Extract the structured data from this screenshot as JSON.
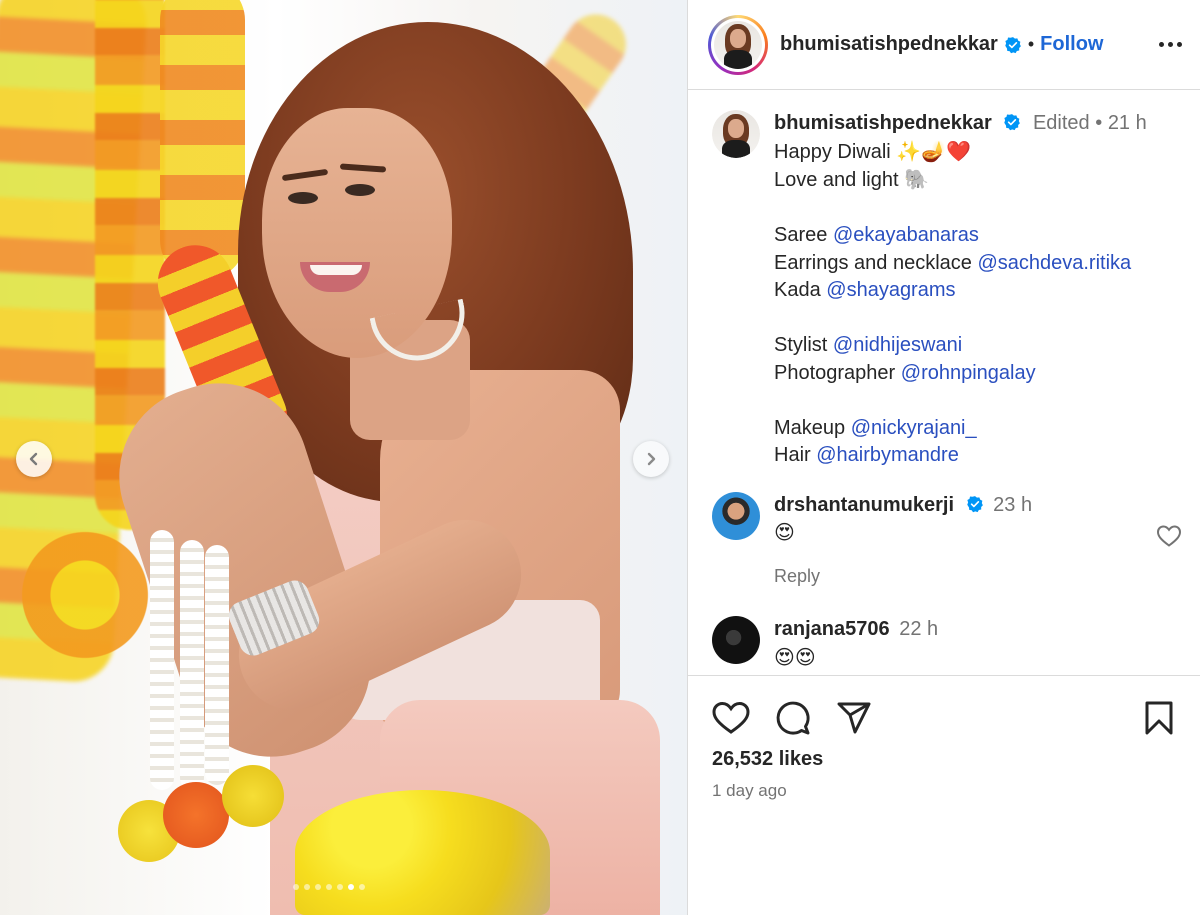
{
  "post": {
    "author": "bhumisatishpednekkar",
    "follow_label": "Follow",
    "separator": "•"
  },
  "caption": {
    "user": "bhumisatishpednekkar",
    "edited": "Edited",
    "time": "21 h",
    "line1_text": "Happy Diwali ",
    "line1_emoji": "✨🪔❤️",
    "line2_text": "Love and light ",
    "line2_emoji": "🐘",
    "credits": [
      {
        "label": "Saree ",
        "handle": "@ekayabanaras"
      },
      {
        "label": "Earrings and necklace ",
        "handle": "@sachdeva.ritika"
      },
      {
        "label": "Kada ",
        "handle": "@shayagrams"
      },
      {
        "label": "Stylist ",
        "handle": "@nidhijeswani"
      },
      {
        "label": "Photographer ",
        "handle": "@rohnpingalay"
      },
      {
        "label": "Makeup ",
        "handle": "@nickyrajani_"
      },
      {
        "label": "Hair ",
        "handle": "@hairbymandre"
      }
    ]
  },
  "comments": [
    {
      "user": "drshantanumukerji",
      "time": "23 h",
      "text": "😍",
      "reply": "Reply"
    },
    {
      "user": "ranjana5706",
      "time": "22 h",
      "text": "😍😍"
    }
  ],
  "stats": {
    "likes": "26,532 likes",
    "posted": "1 day ago"
  },
  "carousel": {
    "count": 7,
    "active_index": 5
  },
  "colors": {
    "verified": "#0095f6",
    "link": "#2a4fbf",
    "follow": "#1e67d6"
  },
  "icons": [
    "heart-icon",
    "comment-icon",
    "share-icon",
    "bookmark-icon",
    "more-icon",
    "chevron-left-icon",
    "chevron-right-icon",
    "verified-badge-icon"
  ]
}
